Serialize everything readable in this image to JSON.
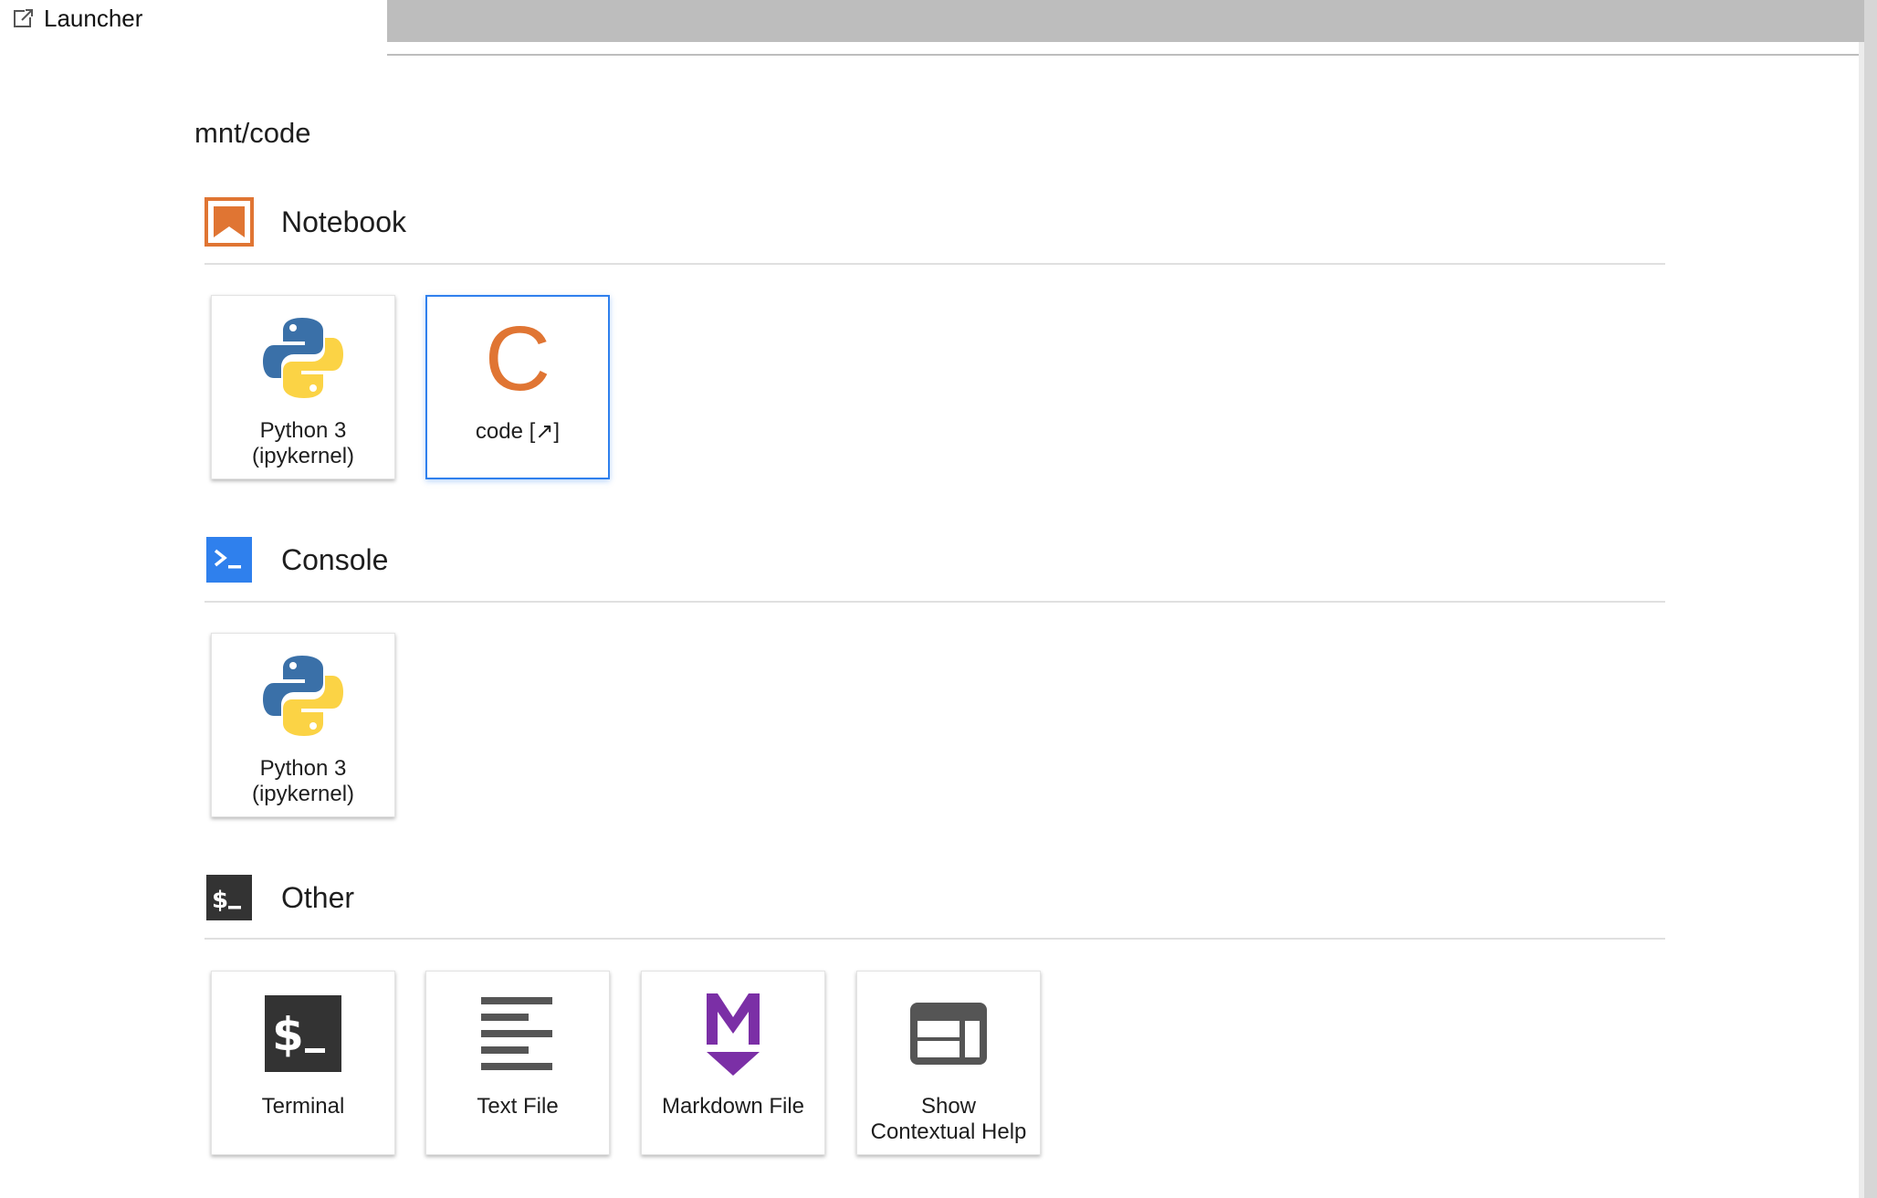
{
  "tab": {
    "label": "Launcher",
    "icon": "launcher-icon"
  },
  "cwd": "mnt/code",
  "colors": {
    "notebook_accent": "#e07533",
    "console_accent": "#2f80ed",
    "other_accent": "#333333",
    "markdown_accent": "#7b2fa6",
    "selected_border": "#2f80ed"
  },
  "sections": {
    "notebook": {
      "title": "Notebook",
      "icon": "notebook-icon",
      "cards": [
        {
          "label_line1": "Python 3",
          "label_line2": "(ipykernel)",
          "icon": "python-logo-icon"
        },
        {
          "label_line1": "code [↗]",
          "label_line2": "",
          "icon": "letter-c-icon",
          "icon_text": "C"
        }
      ]
    },
    "console": {
      "title": "Console",
      "icon": "console-icon",
      "cards": [
        {
          "label_line1": "Python 3",
          "label_line2": "(ipykernel)",
          "icon": "python-logo-icon"
        }
      ]
    },
    "other": {
      "title": "Other",
      "icon": "terminal-section-icon",
      "cards": [
        {
          "label_line1": "Terminal",
          "label_line2": "",
          "icon": "terminal-icon"
        },
        {
          "label_line1": "Text File",
          "label_line2": "",
          "icon": "text-file-icon"
        },
        {
          "label_line1": "Markdown File",
          "label_line2": "",
          "icon": "markdown-icon"
        },
        {
          "label_line1": "Show",
          "label_line2": "Contextual Help",
          "icon": "contextual-help-icon"
        }
      ]
    }
  }
}
